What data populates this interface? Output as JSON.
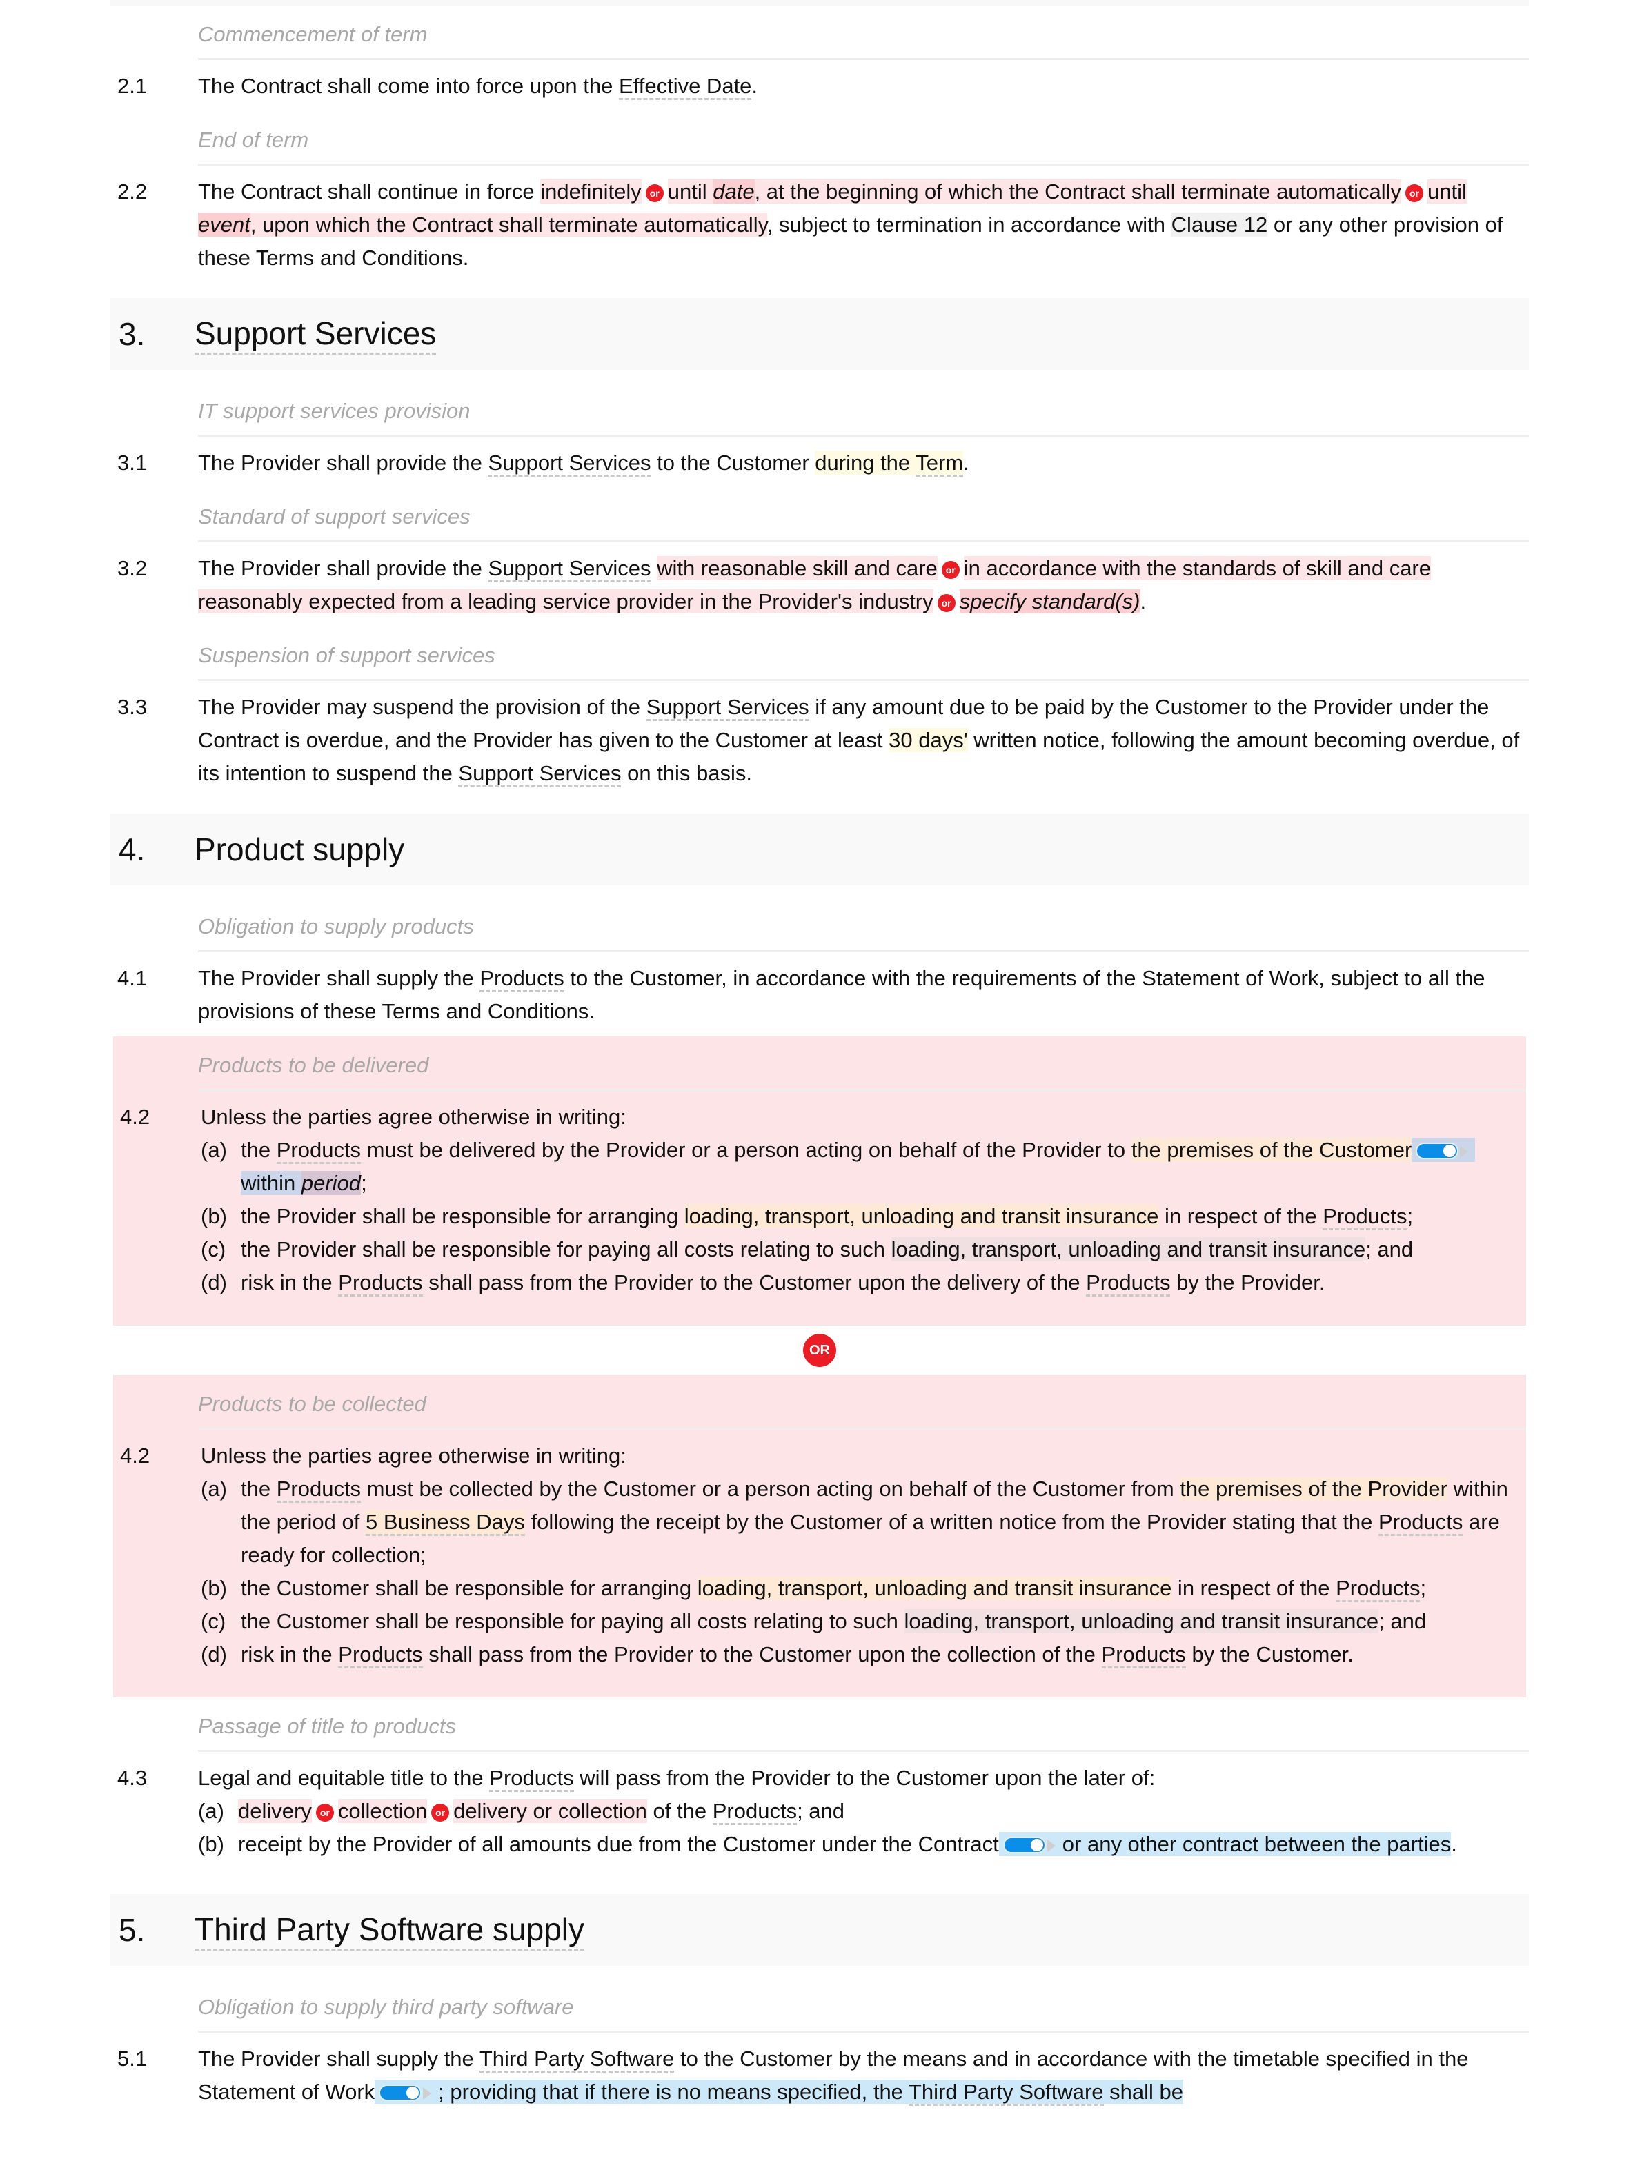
{
  "colors": {
    "option_bg": "#fde4e6",
    "option_dark_bg": "#fbcfd2",
    "or_badge": "#ec1c24",
    "toggle_blue": "#0a8ee8",
    "variable_yellow": "#fffbe3",
    "variable_orange": "#fde9d6",
    "optional_blue": "#cde8f9",
    "heading_bg": "#f9f9f9",
    "caption_text": "#a8a8a8"
  },
  "or_label": "or",
  "or_big_label": "OR",
  "s2": {
    "c1": {
      "caption": "Commencement of term",
      "num": "2.1",
      "t1": "The Contract shall come into force upon the ",
      "def1": "Effective Date",
      "t2": "."
    },
    "c2": {
      "caption": "End of term",
      "num": "2.2",
      "t1": "The Contract shall continue in force ",
      "opt1": "indefinitely",
      "opt2a": "until ",
      "opt2var": "date",
      "opt2b": ", at the beginning of which the Contract shall terminate automatically",
      "opt3a": "until ",
      "opt3var": "event",
      "opt3b": ", upon which the Contract shall terminate automatically",
      "t2": ", subject to termination in accordance with ",
      "ref": "Clause 12",
      "t3": " or any other provision of these Terms and Conditions."
    }
  },
  "s3": {
    "num": "3.",
    "title": "Support Services",
    "c1": {
      "caption": "IT support services provision",
      "num": "3.1",
      "t1": "The Provider shall provide the ",
      "def1": "Support Services",
      "t2": " to the Customer ",
      "var1a": "during the ",
      "var1def": "Term",
      "t3": "."
    },
    "c2": {
      "caption": "Standard of support services",
      "num": "3.2",
      "t1": "The Provider shall provide the ",
      "def1": "Support Services",
      "t2": " ",
      "opt1": "with reasonable skill and care",
      "opt2": "in accordance with the standards of skill and care reasonably expected from a leading service provider in the Provider's industry",
      "opt3": "specify standard(s)",
      "t3": "."
    },
    "c3": {
      "caption": "Suspension of support services",
      "num": "3.3",
      "t1": "The Provider may suspend the provision of the ",
      "def1": "Support Services",
      "t2": " if any amount due to be paid by the Customer to the Provider under the Contract is overdue, and the Provider has given to the Customer at least ",
      "var1": "30 days'",
      "t3": " written notice, following the amount becoming overdue, of its intention to suspend the ",
      "def2": "Support Services",
      "t4": " on this basis."
    }
  },
  "s4": {
    "num": "4.",
    "title": "Product supply",
    "c1": {
      "caption": "Obligation to supply products",
      "num": "4.1",
      "t1": "The Provider shall supply the ",
      "def1": "Products",
      "t2": " to the Customer, in accordance with the requirements of the Statement of Work, subject to all the provisions of these Terms and Conditions."
    },
    "alt1": {
      "caption": "Products to be delivered",
      "num": "4.2",
      "intro": "Unless the parties agree otherwise in writing:",
      "a": {
        "lbl": "(a)",
        "t1": "the ",
        "def1": "Products",
        "t2": " must be delivered by the Provider or a person acting on behalf of the Provider to ",
        "var1": "the premises of the Customer",
        "opt_text": "within ",
        "opt_var": "period",
        "t3": ";"
      },
      "b": {
        "lbl": "(b)",
        "t1": "the Provider shall be responsible for arranging ",
        "var1": "loading, transport, unloading and transit insurance",
        "t2": " in respect of the ",
        "def1": "Products",
        "t3": ";"
      },
      "c": {
        "lbl": "(c)",
        "t1": "the Provider shall be responsible for paying all costs relating to such ",
        "var1": "loading, transport, unloading and transit insurance",
        "t2": "; and"
      },
      "d": {
        "lbl": "(d)",
        "t1": "risk in the ",
        "def1": "Products",
        "t2": " shall pass from the Provider to the Customer upon the delivery of the ",
        "def2": "Products",
        "t3": " by the Provider."
      }
    },
    "alt2": {
      "caption": "Products to be collected",
      "num": "4.2",
      "intro": "Unless the parties agree otherwise in writing:",
      "a": {
        "lbl": "(a)",
        "t1": "the ",
        "def1": "Products",
        "t2": " must be collected by the Customer or a person acting on behalf of the Customer from ",
        "var1": "the premises of the Provider",
        "t3": " within the period of ",
        "var2": "5 Business Days",
        "t4": " following the receipt by the Customer of a written notice from the Provider stating that the ",
        "def2": "Products",
        "t5": " are ready for collection;"
      },
      "b": {
        "lbl": "(b)",
        "t1": "the Customer shall be responsible for arranging ",
        "var1": "loading, transport, unloading and transit insurance",
        "t2": " in respect of the ",
        "def1": "Products",
        "t3": ";"
      },
      "c": {
        "lbl": "(c)",
        "t1": "the Customer shall be responsible for paying all costs relating to such ",
        "var1": "loading, transport, unloading and transit insurance",
        "t2": "; and"
      },
      "d": {
        "lbl": "(d)",
        "t1": "risk in the ",
        "def1": "Products",
        "t2": " shall pass from the Provider to the Customer upon the collection of the ",
        "def2": "Products",
        "t3": " by the Customer."
      }
    },
    "c3": {
      "caption": "Passage of title to products",
      "num": "4.3",
      "intro1": "Legal and equitable title to the ",
      "introdef": "Products",
      "intro2": " will pass from the Provider to the Customer upon the later of:",
      "a": {
        "lbl": "(a)",
        "opt1": "delivery",
        "opt2": "collection",
        "opt3": "delivery or collection",
        "t1": " of the ",
        "def1": "Products",
        "t2": "; and"
      },
      "b": {
        "lbl": "(b)",
        "t1": "receipt by the Provider of all amounts due from the Customer under the Contract",
        "opt_text": "or any other contract between the parties",
        "t2": "."
      }
    }
  },
  "s5": {
    "num": "5.",
    "title": "Third Party Software supply",
    "c1": {
      "caption": "Obligation to supply third party software",
      "num": "5.1",
      "t1": "The Provider shall supply the ",
      "def1": "Third Party Software",
      "t2": " to the Customer by the means and in accordance with the timetable specified in the Statement of Work",
      "opt_text1": "; providing that if there is no means specified, the ",
      "opt_def": "Third Party Software",
      "opt_text2": " shall be"
    }
  }
}
